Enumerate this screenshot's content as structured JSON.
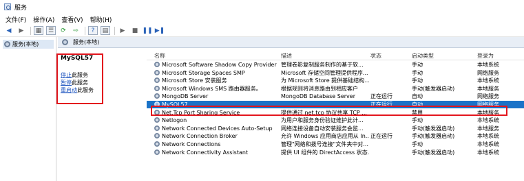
{
  "window": {
    "title": "服务"
  },
  "menu": [
    "文件(F)",
    "操作(A)",
    "查看(V)",
    "帮助(H)"
  ],
  "toolbar": {
    "buttons": [
      "back-icon",
      "forward-icon",
      "console-tree-icon",
      "list-icon",
      "refresh-icon",
      "export-icon",
      "help-icon",
      "properties-icon",
      "start-icon",
      "stop-icon",
      "pause-icon",
      "restart-icon"
    ]
  },
  "tree": {
    "root_label": "服务(本地)"
  },
  "pane_header": {
    "label": "服务(本地)"
  },
  "detail": {
    "service_name": "MySQL57",
    "actions": [
      {
        "link": "停止",
        "suffix": "此服务"
      },
      {
        "link": "暂停",
        "suffix": "此服务"
      },
      {
        "link": "重启动",
        "suffix": "此服务"
      }
    ]
  },
  "table": {
    "columns": [
      "名称",
      "描述",
      "状态",
      "启动类型",
      "登录为"
    ],
    "rows": [
      {
        "name": "Microsoft Software Shadow Copy Provider",
        "desc": "管理卷影复制服务制作的基于软...",
        "status": "",
        "startup": "手动",
        "logon": "本地系统"
      },
      {
        "name": "Microsoft Storage Spaces SMP",
        "desc": "Microsoft 存储空间管理提供程序...",
        "status": "",
        "startup": "手动",
        "logon": "网络服务"
      },
      {
        "name": "Microsoft Store 安装服务",
        "desc": "为 Microsoft Store 提供基础结构...",
        "status": "",
        "startup": "手动",
        "logon": "本地系统"
      },
      {
        "name": "Microsoft Windows SMS 路由器服务。",
        "desc": "根据规则将消息路由到相应客户",
        "status": "",
        "startup": "手动(触发器启动)",
        "logon": "本地服务"
      },
      {
        "name": "MongoDB Server",
        "desc": "MongoDB Database Server",
        "status": "正在运行",
        "startup": "自动",
        "logon": "网络服务"
      },
      {
        "name": "MySQL57",
        "desc": "",
        "status": "正在运行",
        "startup": "自动",
        "logon": "网络服务",
        "selected": true
      },
      {
        "name": "Net.Tcp Port Sharing Service",
        "desc": "提供通过 net.tcp 协议共享 TCP ...",
        "status": "",
        "startup": "禁用",
        "logon": "本地服务"
      },
      {
        "name": "Netlogon",
        "desc": "为用户和服务身份验证维护此计...",
        "status": "",
        "startup": "手动",
        "logon": "本地系统"
      },
      {
        "name": "Network Connected Devices Auto-Setup",
        "desc": "网络连接设备自动安装服务会监...",
        "status": "",
        "startup": "手动(触发器启动)",
        "logon": "本地服务"
      },
      {
        "name": "Network Connection Broker",
        "desc": "允许 Windows 应用商店应用从 In...",
        "status": "正在运行",
        "startup": "手动(触发器启动)",
        "logon": "本地系统"
      },
      {
        "name": "Network Connections",
        "desc": "管理\"网络和拨号连接\"文件夹中对...",
        "status": "",
        "startup": "手动",
        "logon": "本地系统"
      },
      {
        "name": "Network Connectivity Assistant",
        "desc": "提供 UI 组件的 DirectAccess 状态...",
        "status": "",
        "startup": "手动(触发器启动)",
        "logon": "本地系统"
      }
    ]
  },
  "colors": {
    "selection": "#1a73c8",
    "highlight_box": "#e3151d",
    "link": "#1f56c0"
  }
}
